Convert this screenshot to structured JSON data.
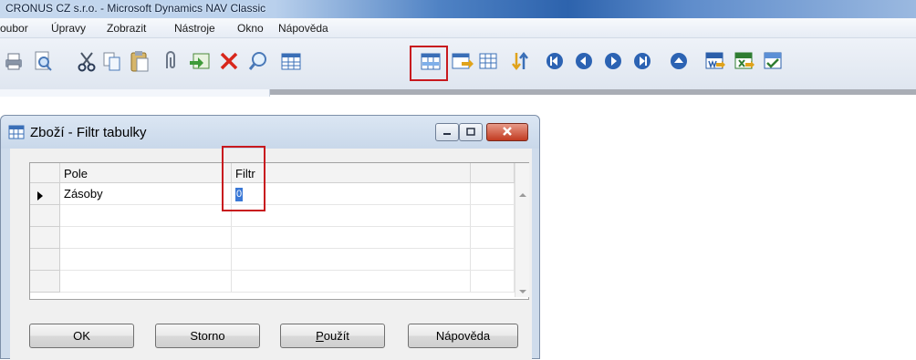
{
  "window": {
    "title": "CRONUS CZ s.r.o. - Microsoft Dynamics NAV Classic"
  },
  "menu": [
    "oubor",
    "Úpravy",
    "Zobrazit",
    "Nástroje",
    "Okno",
    "Nápověda"
  ],
  "toolbar": {
    "icons": [
      "print-icon",
      "print-preview-icon",
      "cut-icon",
      "copy-icon",
      "paste-icon",
      "attach-icon",
      "card-icon",
      "delete-icon",
      "find-icon",
      "table-filter-icon",
      "table-filter-highlighted-icon",
      "flow-filter-icon",
      "show-all-icon",
      "sort-icon",
      "first-record-icon",
      "previous-record-icon",
      "next-record-icon",
      "last-record-icon",
      "up-icon",
      "word-icon",
      "excel-icon",
      "send-icon"
    ],
    "highlight_color": "#c8191e"
  },
  "dialog": {
    "title": "Zboží - Filtr tabulky",
    "columns": {
      "field": "Pole",
      "filter": "Filtr"
    },
    "rows": [
      {
        "field": "Zásoby",
        "filter": "0"
      },
      {
        "field": "",
        "filter": ""
      },
      {
        "field": "",
        "filter": ""
      },
      {
        "field": "",
        "filter": ""
      },
      {
        "field": "",
        "filter": ""
      }
    ],
    "buttons": {
      "ok": "OK",
      "cancel": "Storno",
      "apply_first": "P",
      "apply_rest": "oužít",
      "help": "Nápověda"
    }
  }
}
